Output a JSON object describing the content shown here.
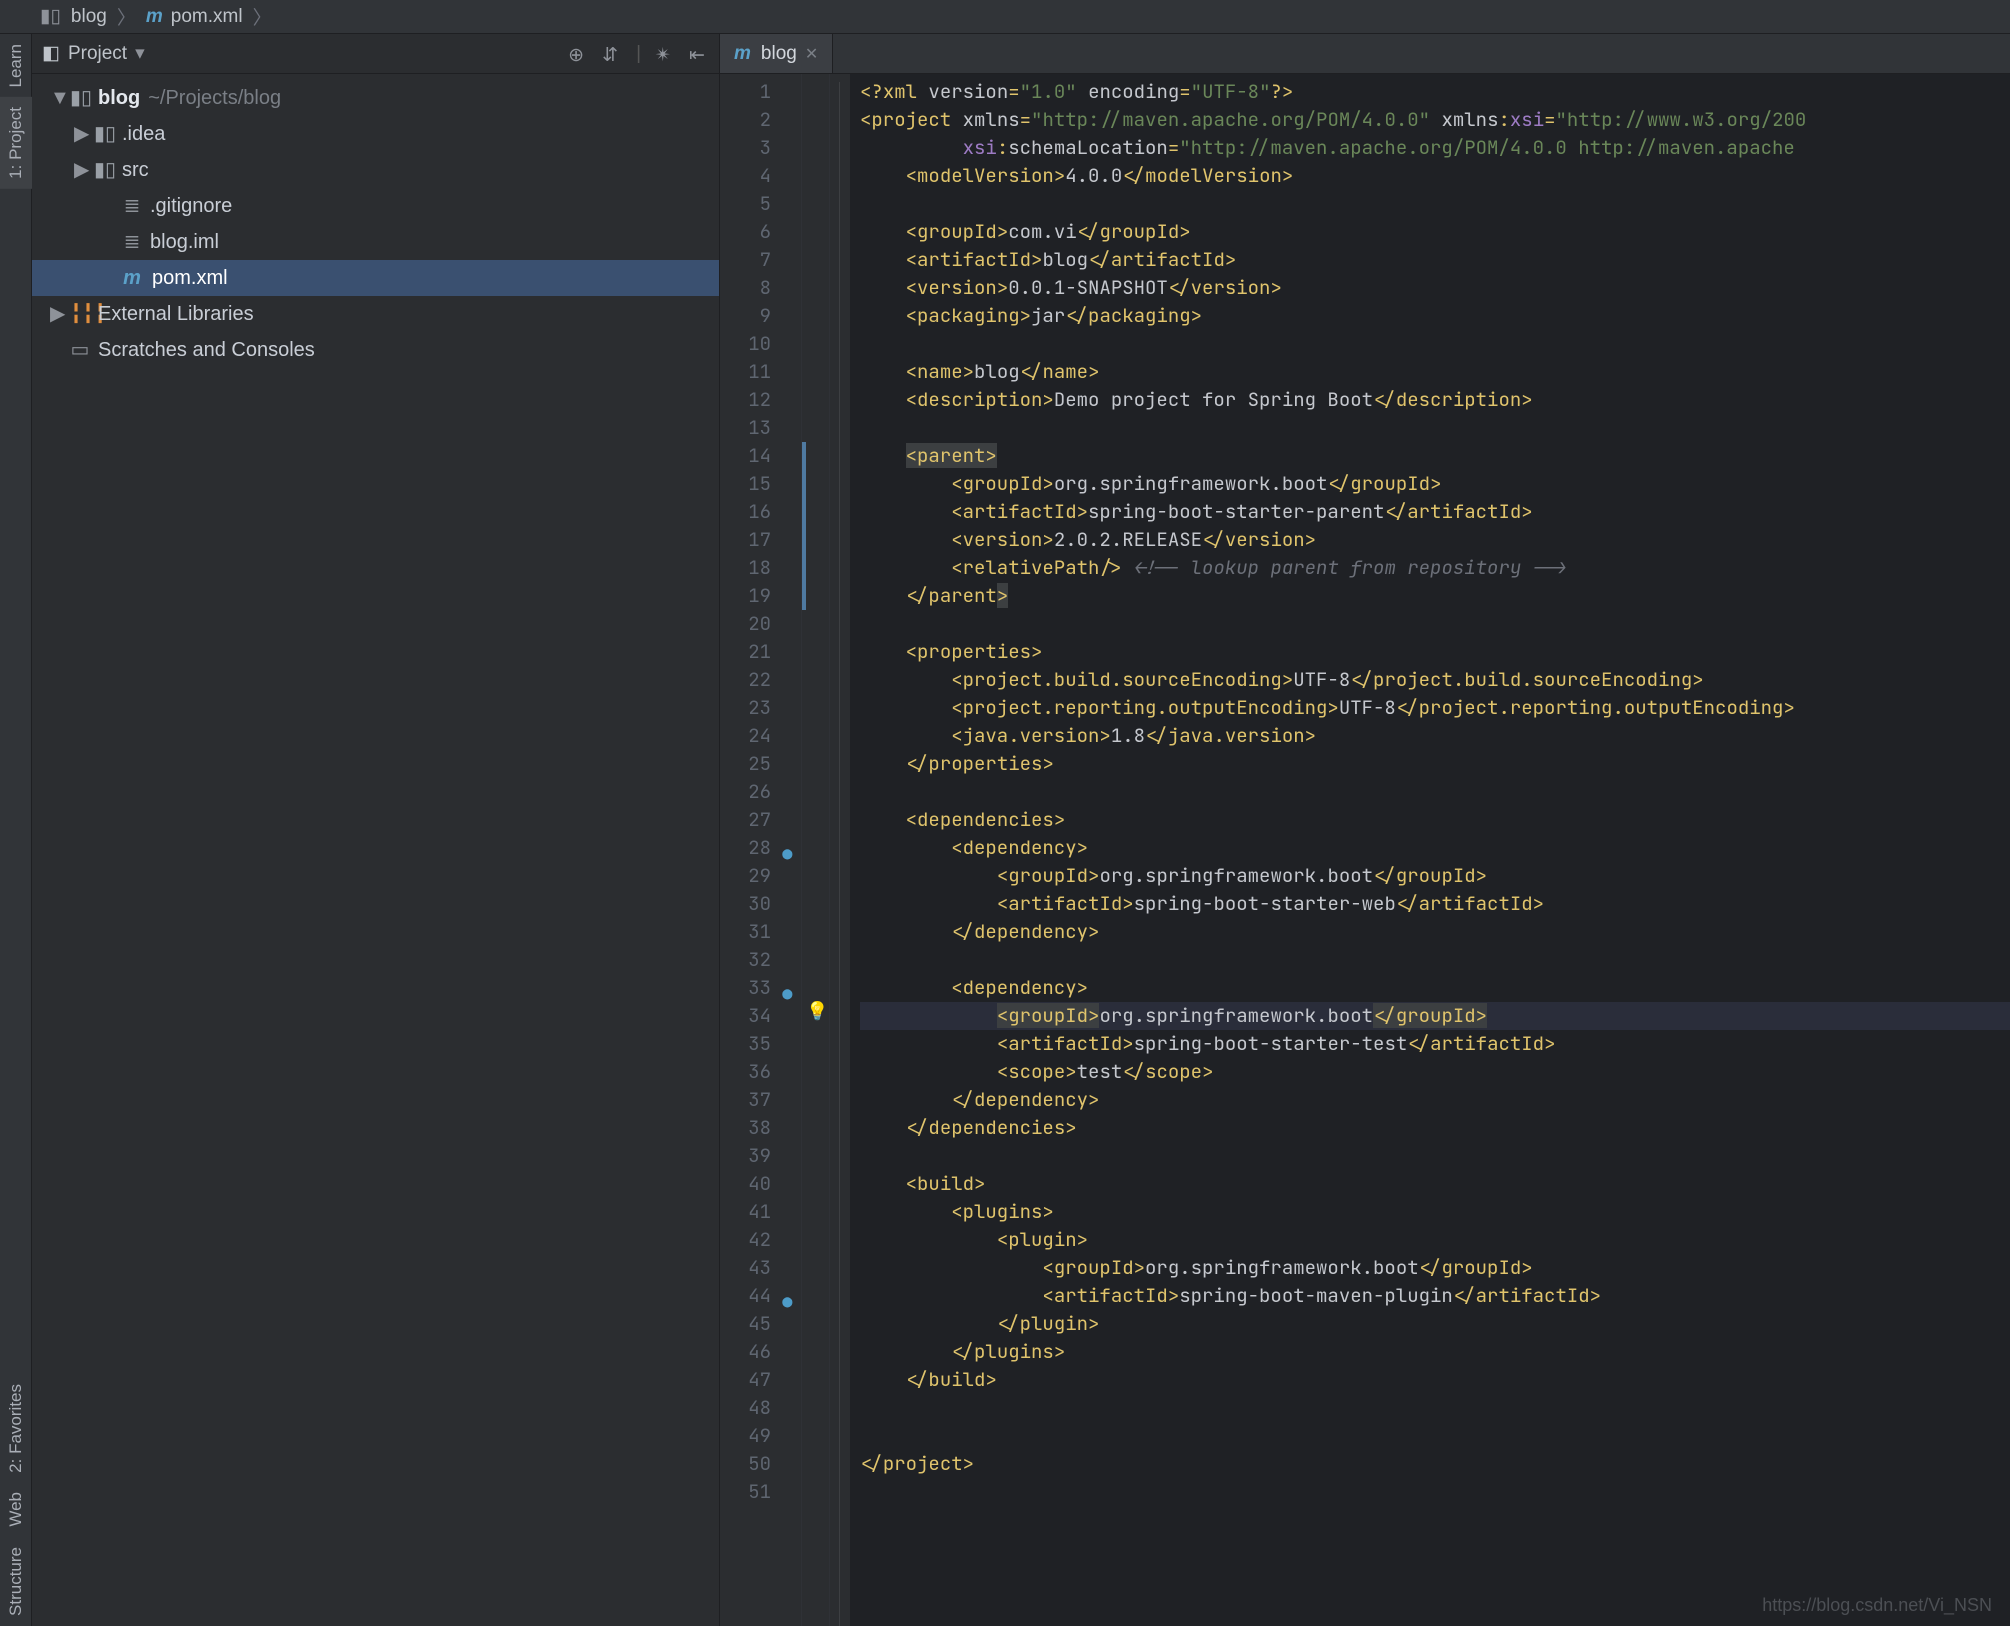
{
  "breadcrumb": {
    "root": "blog",
    "file_prefix": "m",
    "file": "pom.xml"
  },
  "sidebar_rail": {
    "learn": "Learn",
    "project": "1: Project",
    "favorites": "2: Favorites",
    "web": "Web",
    "structure": "Structure"
  },
  "project_panel": {
    "title": "Project",
    "root": {
      "name": "blog",
      "path": "~/Projects/blog"
    },
    "children": [
      {
        "name": ".idea",
        "type": "folder",
        "depth": 1
      },
      {
        "name": "src",
        "type": "folder",
        "depth": 1
      },
      {
        "name": ".gitignore",
        "type": "file",
        "depth": 2
      },
      {
        "name": "blog.iml",
        "type": "file",
        "depth": 2
      },
      {
        "name": "pom.xml",
        "type": "mvn",
        "depth": 2,
        "selected": true
      }
    ],
    "external": "External Libraries",
    "scratches": "Scratches and Consoles"
  },
  "editor_tab": {
    "prefix": "m",
    "label": "blog"
  },
  "code_lines": [
    {
      "n": 1,
      "html": "<span class='b'>&lt;?</span><span class='t'>xml</span> <span class='a'>version</span><span class='b'>=</span><span class='v'>\"1.0\"</span> <span class='a'>encoding</span><span class='b'>=</span><span class='v'>\"UTF-8\"</span><span class='b'>?&gt;</span>"
    },
    {
      "n": 2,
      "html": "<span class='b'>&lt;</span><span class='t'>project</span> <span class='a'>xmlns</span><span class='b'>=</span><span class='v'>\"http://maven.apache.org/POM/4.0.0\"</span> <span class='a'>xmlns</span><span class='b'>:</span><span class='ns'>xsi</span><span class='b'>=</span><span class='v'>\"http://www.w3.org/200</span>"
    },
    {
      "n": 3,
      "html": "         <span class='ns'>xsi</span><span class='b'>:</span><span class='a'>schemaLocation</span><span class='b'>=</span><span class='v'>\"http://maven.apache.org/POM/4.0.0 http://maven.apache</span>"
    },
    {
      "n": 4,
      "html": "    <span class='b'>&lt;</span><span class='t'>modelVersion</span><span class='b'>&gt;</span><span class='tx'>4.0.0</span><span class='b'>&lt;/</span><span class='t'>modelVersion</span><span class='b'>&gt;</span>"
    },
    {
      "n": 5,
      "html": ""
    },
    {
      "n": 6,
      "html": "    <span class='b'>&lt;</span><span class='t'>groupId</span><span class='b'>&gt;</span><span class='tx'>com.vi</span><span class='b'>&lt;/</span><span class='t'>groupId</span><span class='b'>&gt;</span>"
    },
    {
      "n": 7,
      "html": "    <span class='b'>&lt;</span><span class='t'>artifactId</span><span class='b'>&gt;</span><span class='tx'>blog</span><span class='b'>&lt;/</span><span class='t'>artifactId</span><span class='b'>&gt;</span>"
    },
    {
      "n": 8,
      "html": "    <span class='b'>&lt;</span><span class='t'>version</span><span class='b'>&gt;</span><span class='tx'>0.0.1-SNAPSHOT</span><span class='b'>&lt;/</span><span class='t'>version</span><span class='b'>&gt;</span>"
    },
    {
      "n": 9,
      "html": "    <span class='b'>&lt;</span><span class='t'>packaging</span><span class='b'>&gt;</span><span class='tx'>jar</span><span class='b'>&lt;/</span><span class='t'>packaging</span><span class='b'>&gt;</span>"
    },
    {
      "n": 10,
      "html": ""
    },
    {
      "n": 11,
      "html": "    <span class='b'>&lt;</span><span class='t'>name</span><span class='b'>&gt;</span><span class='tx'>blog</span><span class='b'>&lt;/</span><span class='t'>name</span><span class='b'>&gt;</span>"
    },
    {
      "n": 12,
      "html": "    <span class='b'>&lt;</span><span class='t'>description</span><span class='b'>&gt;</span><span class='tx'>Demo project for Spring Boot</span><span class='b'>&lt;/</span><span class='t'>description</span><span class='b'>&gt;</span>"
    },
    {
      "n": 13,
      "html": ""
    },
    {
      "n": 14,
      "html": "    <span class='hl-bg'><span class='b'>&lt;</span><span class='t'>parent</span><span class='b'>&gt;</span></span>",
      "bar": true
    },
    {
      "n": 15,
      "html": "        <span class='b'>&lt;</span><span class='t'>groupId</span><span class='b'>&gt;</span><span class='tx'>org.springframework.boot</span><span class='b'>&lt;/</span><span class='t'>groupId</span><span class='b'>&gt;</span>",
      "bar": true
    },
    {
      "n": 16,
      "html": "        <span class='b'>&lt;</span><span class='t'>artifactId</span><span class='b'>&gt;</span><span class='tx'>spring-boot-starter-parent</span><span class='b'>&lt;/</span><span class='t'>artifactId</span><span class='b'>&gt;</span>",
      "bar": true
    },
    {
      "n": 17,
      "html": "        <span class='b'>&lt;</span><span class='t'>version</span><span class='b'>&gt;</span><span class='tx'>2.0.2.RELEASE</span><span class='b'>&lt;/</span><span class='t'>version</span><span class='b'>&gt;</span>",
      "bar": true
    },
    {
      "n": 18,
      "html": "        <span class='b'>&lt;</span><span class='t'>relativePath</span><span class='b'>/&gt;</span> <span class='c'>&lt;!-- lookup parent from repository --&gt;</span>",
      "bar": true
    },
    {
      "n": 19,
      "html": "    <span class='b'>&lt;/</span><span class='t'>parent</span><span class='hl-bg'><span class='b'>&gt;</span></span>",
      "bar": true
    },
    {
      "n": 20,
      "html": ""
    },
    {
      "n": 21,
      "html": "    <span class='b'>&lt;</span><span class='t'>properties</span><span class='b'>&gt;</span>"
    },
    {
      "n": 22,
      "html": "        <span class='b'>&lt;</span><span class='t'>project.build.sourceEncoding</span><span class='b'>&gt;</span><span class='tx'>UTF-8</span><span class='b'>&lt;/</span><span class='t'>project.build.sourceEncoding</span><span class='b'>&gt;</span>"
    },
    {
      "n": 23,
      "html": "        <span class='b'>&lt;</span><span class='t'>project.reporting.outputEncoding</span><span class='b'>&gt;</span><span class='tx'>UTF-8</span><span class='b'>&lt;/</span><span class='t'>project.reporting.outputEncoding</span><span class='b'>&gt;</span>"
    },
    {
      "n": 24,
      "html": "        <span class='b'>&lt;</span><span class='t'>java.version</span><span class='b'>&gt;</span><span class='tx'>1.8</span><span class='b'>&lt;/</span><span class='t'>java.version</span><span class='b'>&gt;</span>"
    },
    {
      "n": 25,
      "html": "    <span class='b'>&lt;/</span><span class='t'>properties</span><span class='b'>&gt;</span>"
    },
    {
      "n": 26,
      "html": ""
    },
    {
      "n": 27,
      "html": "    <span class='b'>&lt;</span><span class='t'>dependencies</span><span class='b'>&gt;</span>"
    },
    {
      "n": 28,
      "html": "        <span class='b'>&lt;</span><span class='t'>dependency</span><span class='b'>&gt;</span>"
    },
    {
      "n": 29,
      "html": "            <span class='b'>&lt;</span><span class='t'>groupId</span><span class='b'>&gt;</span><span class='tx'>org.springframework.boot</span><span class='b'>&lt;/</span><span class='t'>groupId</span><span class='b'>&gt;</span>"
    },
    {
      "n": 30,
      "html": "            <span class='b'>&lt;</span><span class='t'>artifactId</span><span class='b'>&gt;</span><span class='tx'>spring-boot-starter-web</span><span class='b'>&lt;/</span><span class='t'>artifactId</span><span class='b'>&gt;</span>"
    },
    {
      "n": 31,
      "html": "        <span class='b'>&lt;/</span><span class='t'>dependency</span><span class='b'>&gt;</span>"
    },
    {
      "n": 32,
      "html": ""
    },
    {
      "n": 33,
      "html": "        <span class='b'>&lt;</span><span class='t'>dependency</span><span class='b'>&gt;</span>"
    },
    {
      "n": 34,
      "hl": true,
      "bulb": true,
      "html": "            <span class='hl-bg'><span class='b'>&lt;</span><span class='t'>groupId</span><span class='b'>&gt;</span></span><span class='tx'>org.springframework.boot</span><span class='hl-bg'><span class='b'>&lt;/</span><span class='t'>groupId</span><span class='b'>&gt;</span></span>"
    },
    {
      "n": 35,
      "html": "            <span class='b'>&lt;</span><span class='t'>artifactId</span><span class='b'>&gt;</span><span class='tx'>spring-boot-starter-test</span><span class='b'>&lt;/</span><span class='t'>artifactId</span><span class='b'>&gt;</span>"
    },
    {
      "n": 36,
      "html": "            <span class='b'>&lt;</span><span class='t'>scope</span><span class='b'>&gt;</span><span class='tx'>test</span><span class='b'>&lt;/</span><span class='t'>scope</span><span class='b'>&gt;</span>"
    },
    {
      "n": 37,
      "html": "        <span class='b'>&lt;/</span><span class='t'>dependency</span><span class='b'>&gt;</span>"
    },
    {
      "n": 38,
      "html": "    <span class='b'>&lt;/</span><span class='t'>dependencies</span><span class='b'>&gt;</span>"
    },
    {
      "n": 39,
      "html": ""
    },
    {
      "n": 40,
      "html": "    <span class='b'>&lt;</span><span class='t'>build</span><span class='b'>&gt;</span>"
    },
    {
      "n": 41,
      "html": "        <span class='b'>&lt;</span><span class='t'>plugins</span><span class='b'>&gt;</span>"
    },
    {
      "n": 42,
      "html": "            <span class='b'>&lt;</span><span class='t'>plugin</span><span class='b'>&gt;</span>"
    },
    {
      "n": 43,
      "html": "                <span class='b'>&lt;</span><span class='t'>groupId</span><span class='b'>&gt;</span><span class='tx'>org.springframework.boot</span><span class='b'>&lt;/</span><span class='t'>groupId</span><span class='b'>&gt;</span>"
    },
    {
      "n": 44,
      "html": "                <span class='b'>&lt;</span><span class='t'>artifactId</span><span class='b'>&gt;</span><span class='tx'>spring-boot-maven-plugin</span><span class='b'>&lt;/</span><span class='t'>artifactId</span><span class='b'>&gt;</span>"
    },
    {
      "n": 45,
      "html": "            <span class='b'>&lt;/</span><span class='t'>plugin</span><span class='b'>&gt;</span>"
    },
    {
      "n": 46,
      "html": "        <span class='b'>&lt;/</span><span class='t'>plugins</span><span class='b'>&gt;</span>"
    },
    {
      "n": 47,
      "html": "    <span class='b'>&lt;/</span><span class='t'>build</span><span class='b'>&gt;</span>"
    },
    {
      "n": 48,
      "html": ""
    },
    {
      "n": 49,
      "html": ""
    },
    {
      "n": 50,
      "html": "<span class='b'>&lt;/</span><span class='t'>project</span><span class='b'>&gt;</span>"
    },
    {
      "n": 51,
      "html": ""
    }
  ],
  "watermark": "https://blog.csdn.net/Vi_NSN"
}
